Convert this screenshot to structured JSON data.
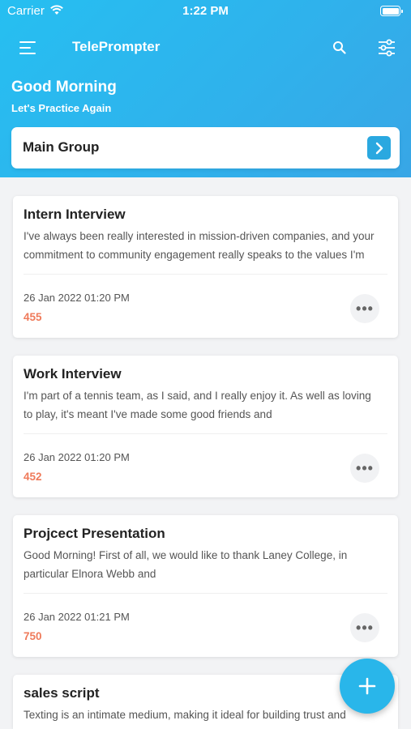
{
  "status_bar": {
    "carrier": "Carrier",
    "time": "1:22 PM"
  },
  "header": {
    "title": "TelePrompter",
    "greeting": "Good Morning",
    "subtitle": "Let's Practice Again",
    "icons": [
      "menu-icon",
      "search-icon",
      "filter-icon"
    ]
  },
  "group": {
    "label": "Main Group"
  },
  "scripts": [
    {
      "title": "Intern Interview",
      "body": "I've always been really interested in mission-driven companies, and your commitment to community engagement really speaks to the values I'm",
      "date": "26 Jan 2022 01:20 PM",
      "count": "455"
    },
    {
      "title": "Work Interview",
      "body": "I'm part of a tennis team, as I said, and I really enjoy it. As well as loving to play, it's meant I've made some good friends and",
      "date": "26 Jan 2022 01:20 PM",
      "count": "452"
    },
    {
      "title": "Projcect Presentation",
      "body": "Good Morning! First of all, we would like to thank Laney College, in particular Elnora Webb and",
      "date": "26 Jan 2022 01:21 PM",
      "count": "750"
    },
    {
      "title": "sales script",
      "body": "Texting is an intimate medium, making it ideal for building trust and",
      "date": "",
      "count": ""
    }
  ],
  "more_label": "•••",
  "colors": {
    "header": "#2fb2ec",
    "accent": "#2aa8e0",
    "count": "#ef7a5a"
  }
}
